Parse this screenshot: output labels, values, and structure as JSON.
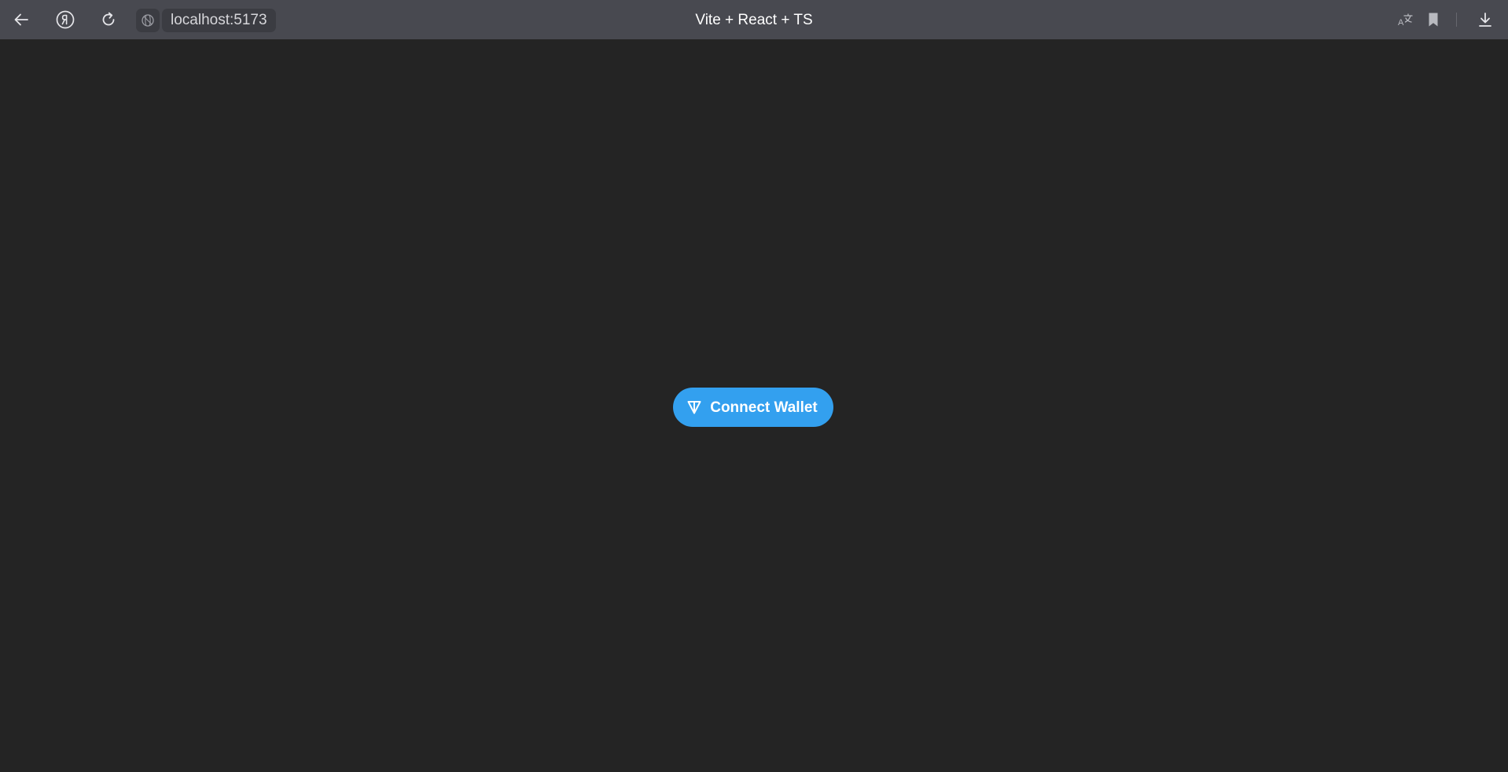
{
  "browser": {
    "url": "localhost:5173",
    "tab_title": "Vite + React + TS",
    "icons": {
      "back": "back-arrow-icon",
      "yandex": "yandex-logo-icon",
      "reload": "reload-icon",
      "site": "site-globe-icon",
      "translate": "translate-icon",
      "bookmark": "bookmark-icon",
      "download": "download-icon"
    }
  },
  "page": {
    "background_color": "#242424",
    "connect_button": {
      "label": "Connect Wallet",
      "icon": "ton-diamond-icon",
      "color": "#33a0ef"
    }
  }
}
